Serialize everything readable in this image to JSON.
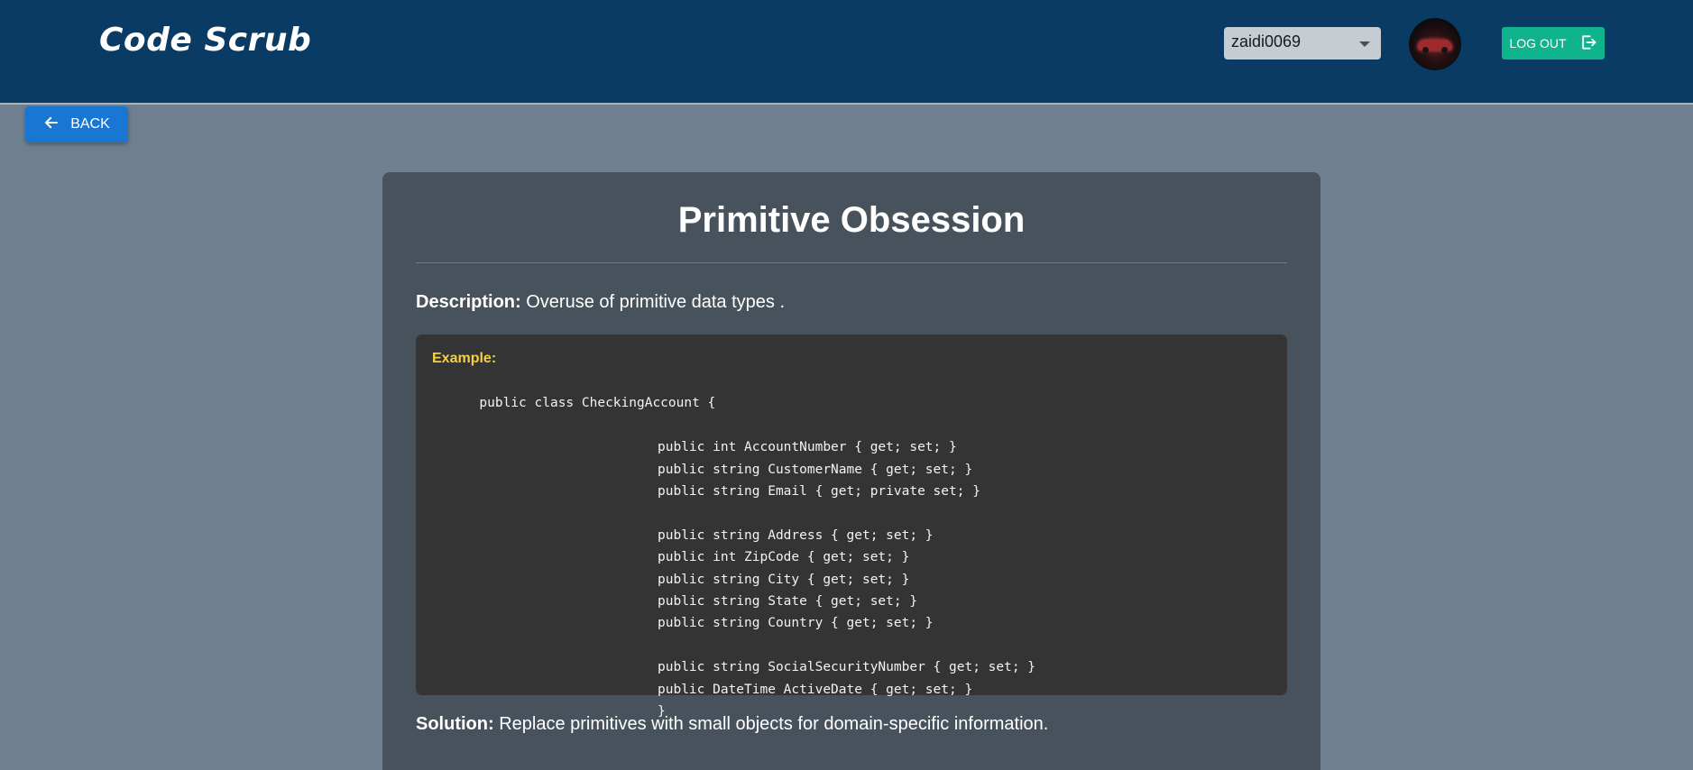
{
  "header": {
    "logo": "Code Scrub",
    "user_select_value": "zaidi0069",
    "logout_label": "LOG OUT"
  },
  "nav": {
    "back_label": "BACK"
  },
  "card": {
    "title": "Primitive Obsession",
    "description_label": "Description:",
    "description_text": " Overuse of primitive data types .",
    "example_label": "Example:",
    "code_first_line": "public class CheckingAccount {",
    "code_lines": [
      "public int AccountNumber { get; set; }",
      "public string CustomerName { get; set; }",
      "public string Email { get; private set; }",
      "",
      "public string Address { get; set; }",
      "public int ZipCode { get; set; }",
      "public string City { get; set; }",
      "public string State { get; set; }",
      "public string Country { get; set; }",
      "",
      "public string SocialSecurityNumber { get; set; }",
      "public DateTime ActiveDate { get; set; }",
      "}"
    ],
    "solution_label": "Solution:",
    "solution_text": " Replace primitives with small objects for domain-specific information."
  },
  "colors": {
    "header_bg": "#093b64",
    "page_bg": "#6f7f8f",
    "card_bg": "#47525d",
    "code_bg": "#343434",
    "accent_green": "#0fb38c",
    "accent_blue": "#1976d2",
    "example_yellow": "#f5d142"
  },
  "icons": {
    "back": "arrow-left-icon",
    "logout": "logout-icon",
    "select": "caret-down-icon"
  }
}
